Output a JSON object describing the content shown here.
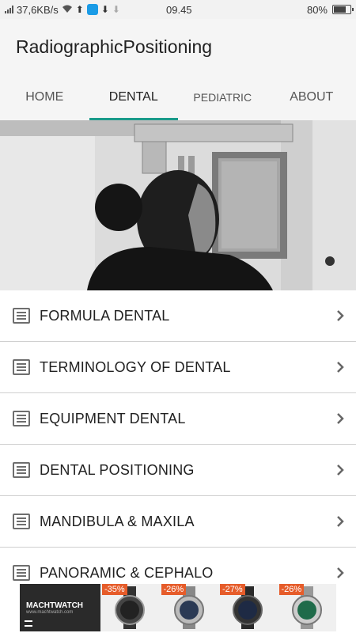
{
  "status_bar": {
    "speed": "37,6KB/s",
    "time": "09.45",
    "battery": "80%",
    "battery_level": 0.8
  },
  "app_bar": {
    "title": "RadiographicPositioning"
  },
  "tabs": [
    {
      "label": "HOME",
      "active": false
    },
    {
      "label": "DENTAL",
      "active": true
    },
    {
      "label": "PEDIATRIC",
      "active": false
    },
    {
      "label": "ABOUT",
      "active": false
    }
  ],
  "menu_items": [
    {
      "label": "FORMULA DENTAL"
    },
    {
      "label": "TERMINOLOGY OF DENTAL"
    },
    {
      "label": "EQUIPMENT DENTAL"
    },
    {
      "label": "DENTAL POSITIONING"
    },
    {
      "label": "MANDIBULA & MAXILA"
    },
    {
      "label": "PANORAMIC & CEPHALO"
    }
  ],
  "ad": {
    "brand": "MACHTWATCH",
    "brand_url": "www.machtwatch.com",
    "products": [
      {
        "discount": "-35%"
      },
      {
        "discount": "-26%"
      },
      {
        "discount": "-27%"
      },
      {
        "discount": "-26%"
      }
    ]
  },
  "colors": {
    "accent": "#1a9a8a",
    "discount": "#e65c2a"
  }
}
